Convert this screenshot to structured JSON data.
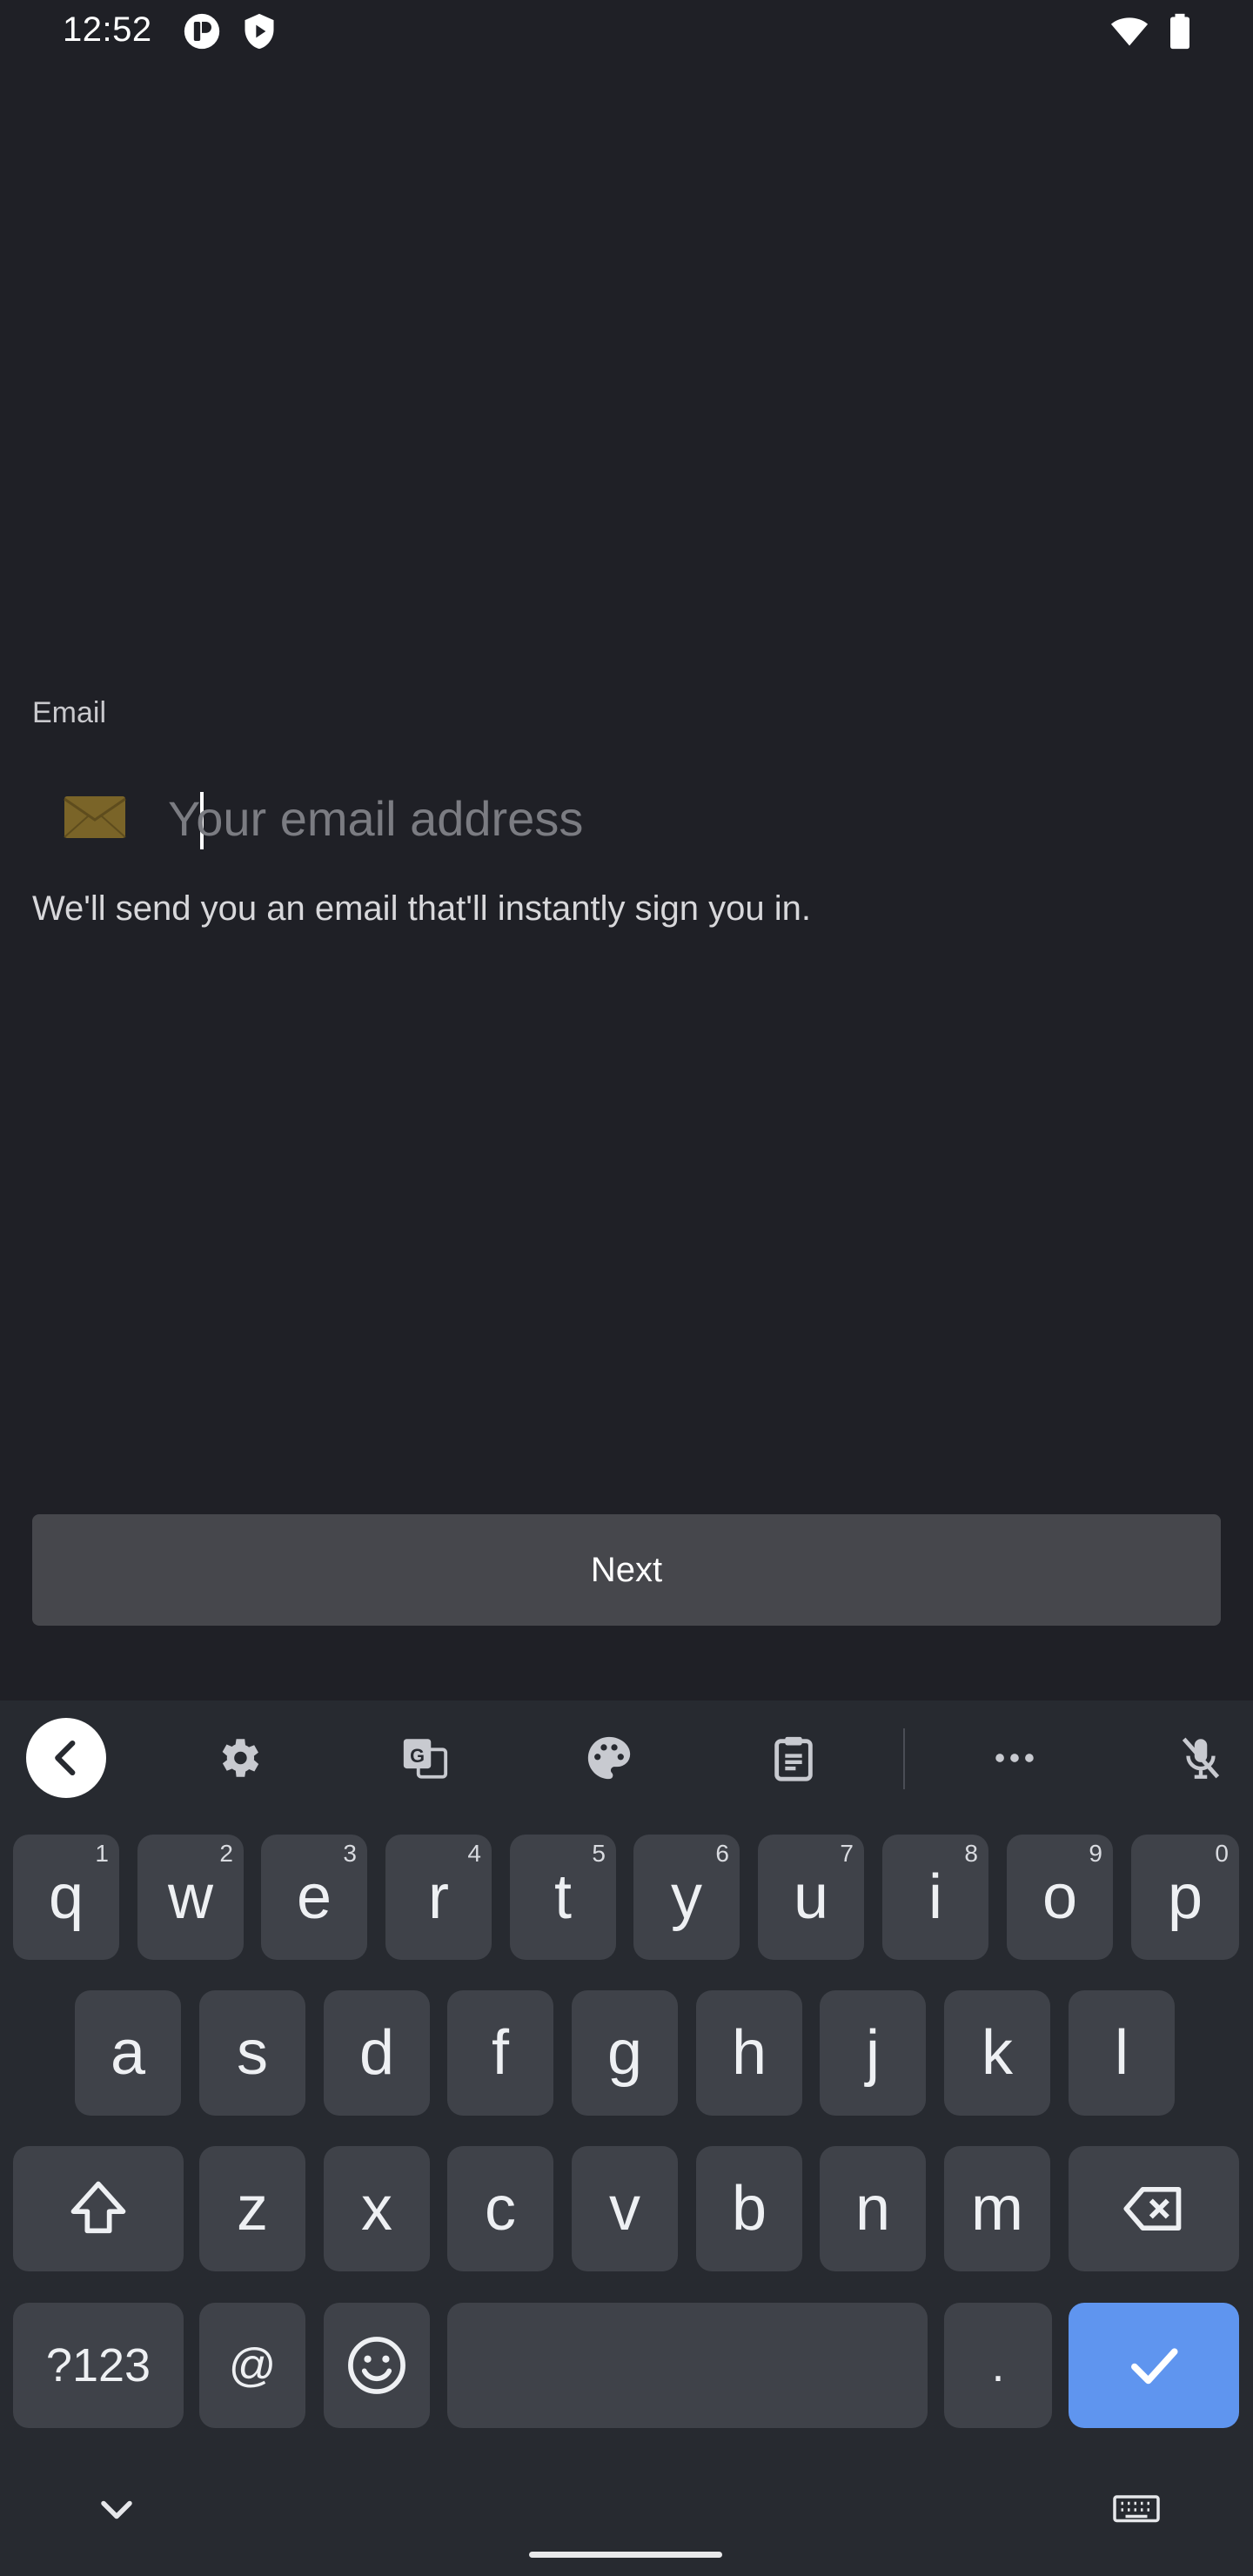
{
  "status_bar": {
    "time": "12:52",
    "left_icons": [
      "app-badge-icon",
      "shield-play-icon"
    ],
    "right_icons": [
      "wifi-icon",
      "battery-icon"
    ]
  },
  "form": {
    "email_label": "Email",
    "email_placeholder": "Your email address",
    "email_value": "",
    "envelope_icon": "envelope-icon",
    "hint": "We'll send you an email that'll instantly sign you in.",
    "next_label": "Next"
  },
  "keyboard": {
    "toolbar": [
      "back-chevron-icon",
      "settings-gear-icon",
      "translate-icon",
      "palette-icon",
      "clipboard-icon",
      "more-dots-icon",
      "mic-off-icon"
    ],
    "row1": [
      {
        "key": "q",
        "sup": "1"
      },
      {
        "key": "w",
        "sup": "2"
      },
      {
        "key": "e",
        "sup": "3"
      },
      {
        "key": "r",
        "sup": "4"
      },
      {
        "key": "t",
        "sup": "5"
      },
      {
        "key": "y",
        "sup": "6"
      },
      {
        "key": "u",
        "sup": "7"
      },
      {
        "key": "i",
        "sup": "8"
      },
      {
        "key": "o",
        "sup": "9"
      },
      {
        "key": "p",
        "sup": "0"
      }
    ],
    "row2": [
      "a",
      "s",
      "d",
      "f",
      "g",
      "h",
      "j",
      "k",
      "l"
    ],
    "row3": [
      "z",
      "x",
      "c",
      "v",
      "b",
      "n",
      "m"
    ],
    "symbols_label": "?123",
    "at_label": "@",
    "period_label": ".",
    "space_label": "",
    "accent_color": "#5f95ef"
  }
}
